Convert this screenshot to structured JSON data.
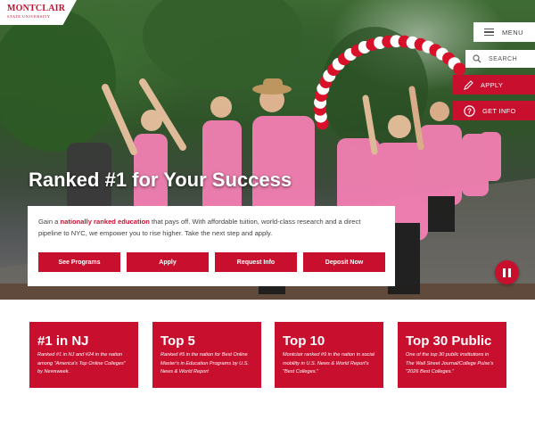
{
  "logo": {
    "name": "MONTCLAIR",
    "sub": "STATE UNIVERSITY"
  },
  "nav": {
    "menu_label": "MENU",
    "search_label": "SEARCH",
    "apply_label": "APPLY",
    "get_info_label": "GET INFO"
  },
  "hero": {
    "headline": "Ranked #1 for Your Success",
    "intro_prefix": "Gain a ",
    "intro_highlight": "nationally ranked education",
    "intro_suffix": " that pays off. With affordable tuition, world-class research and a direct pipeline to NYC, we empower you to rise higher. Take the next step and apply.",
    "buttons": [
      "See Programs",
      "Apply",
      "Request Info",
      "Deposit Now"
    ],
    "balloon_colors": [
      "#d8102a",
      "#ffffff"
    ]
  },
  "stats": [
    {
      "title": "#1 in NJ",
      "desc": "Ranked #1 in NJ and #24 in the nation among \"America's Top Online Colleges\" by Newsweek."
    },
    {
      "title": "Top 5",
      "desc": "Ranked #5 in the nation for Best Online Master's in Education Programs by U.S. News & World Report"
    },
    {
      "title": "Top 10",
      "desc": "Montclair ranked #9 in the nation in social mobility in U.S. News & World Report's \"Best Colleges.\""
    },
    {
      "title": "Top 30 Public",
      "desc": "One of the top 30 public institutions in The Wall Street Journal/College Pulse's \"2026 Best Colleges.\""
    }
  ],
  "colors": {
    "brand_red": "#c8102e",
    "white": "#ffffff"
  }
}
